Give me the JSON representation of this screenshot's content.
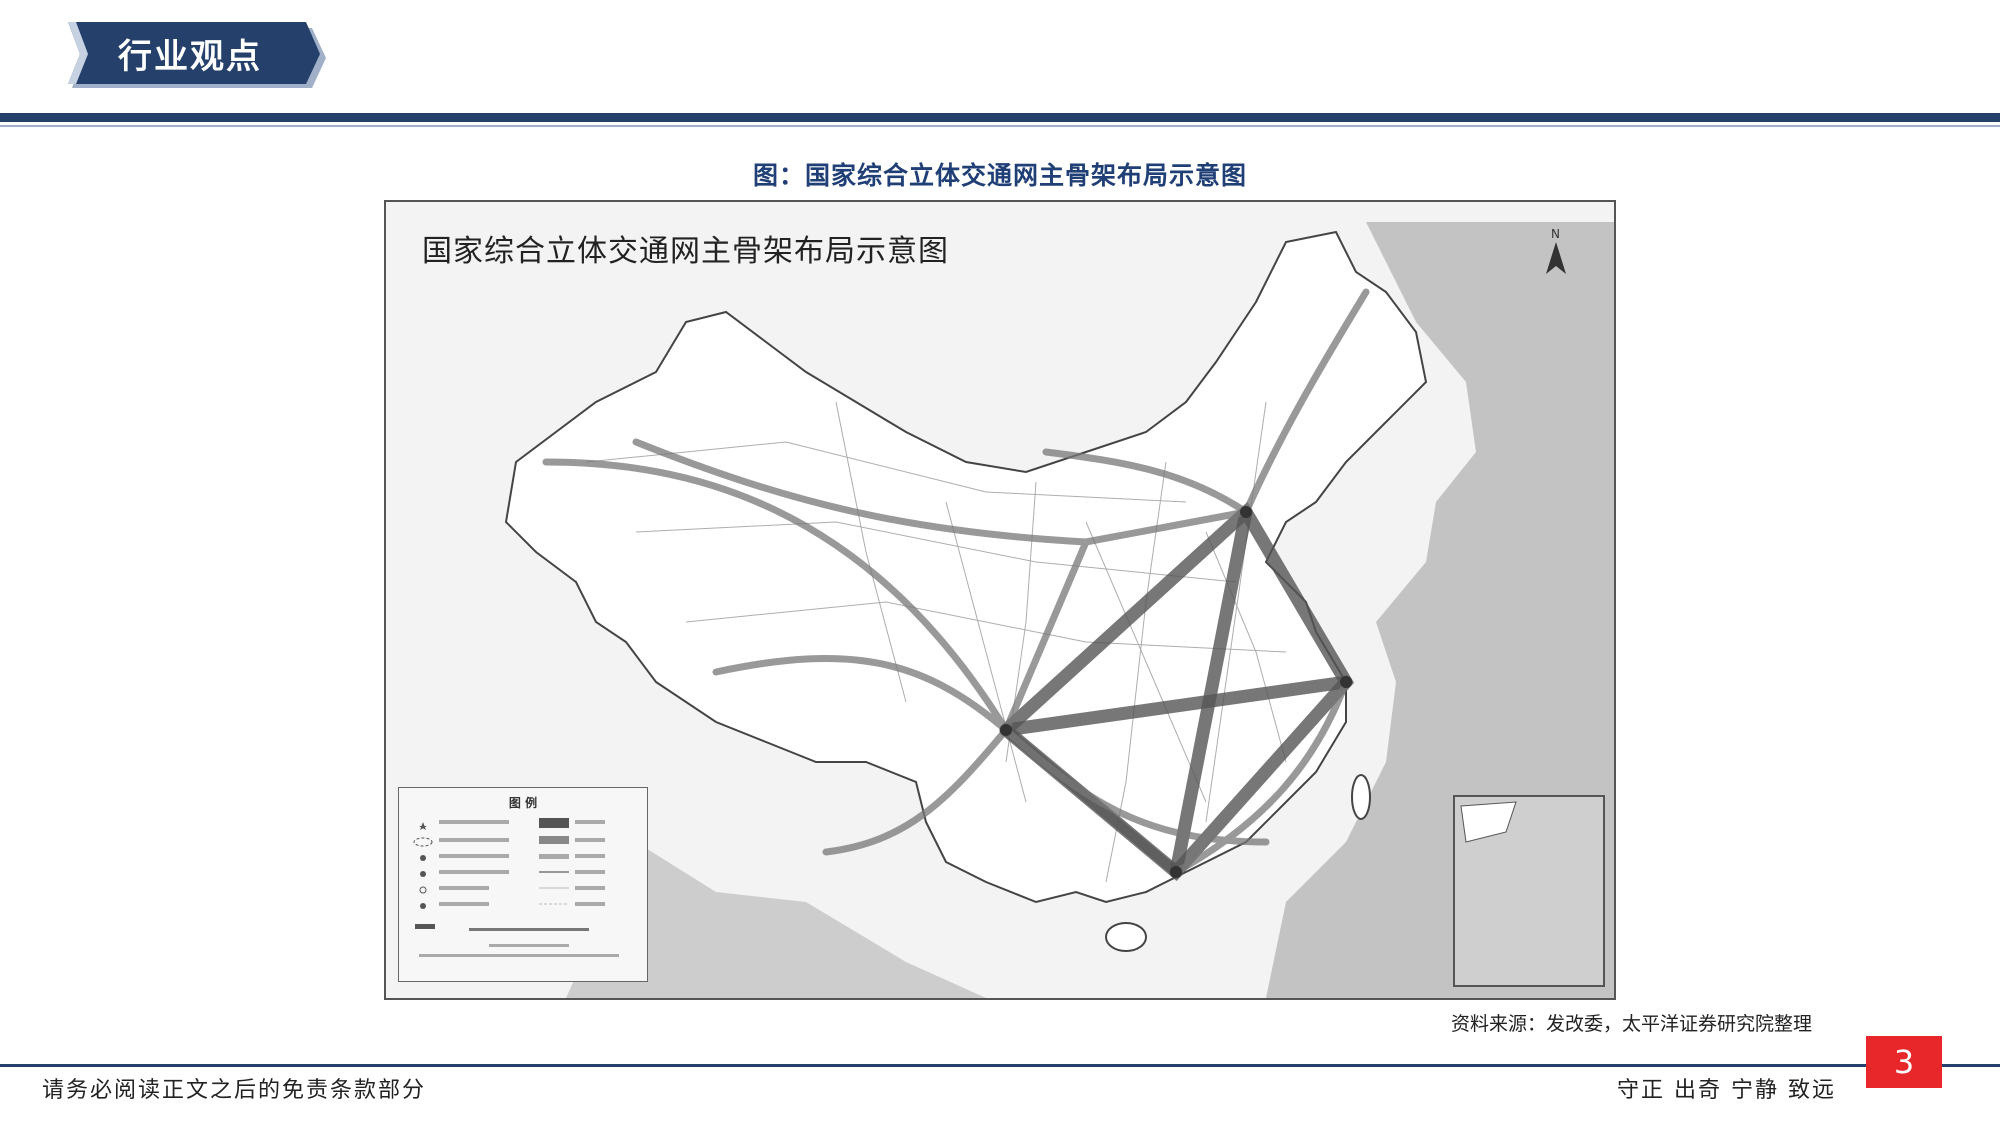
{
  "header": {
    "title": "行业观点"
  },
  "figure": {
    "caption": "图：国家综合立体交通网主骨架布局示意图",
    "map_title": "国家综合立体交通网主骨架布局示意图",
    "legend_title": "图 例"
  },
  "source": "资料来源：发改委，太平洋证券研究院整理",
  "footer": {
    "disclaimer": "请务必阅读正文之后的免责条款部分",
    "motto": "守正 出奇 宁静 致远",
    "page_number": "3"
  },
  "colors": {
    "navy": "#24406b",
    "caption_blue": "#1f3f76",
    "badge_red": "#e8272b"
  }
}
